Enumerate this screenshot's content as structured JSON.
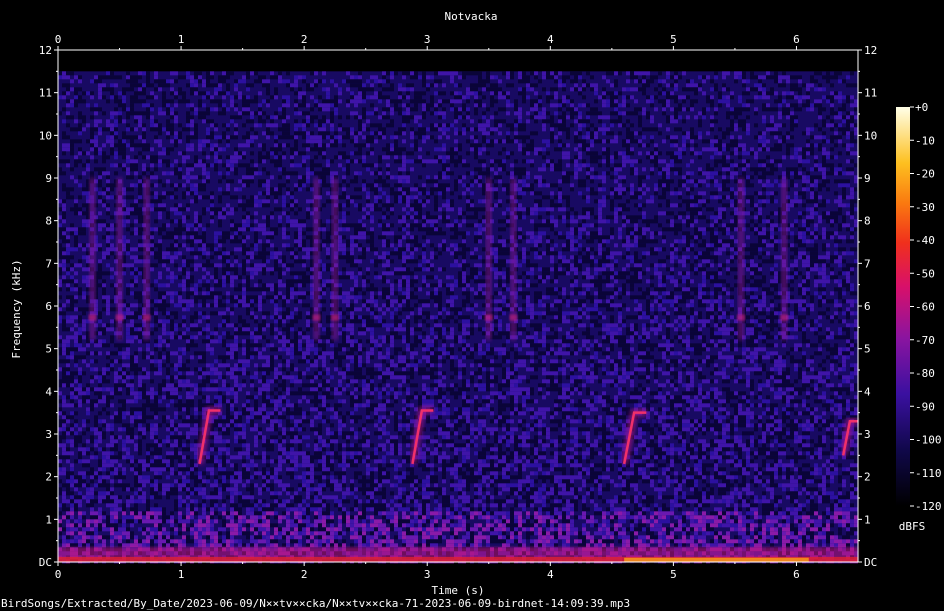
{
  "chart_data": {
    "type": "heatmap",
    "title": "Notvacka",
    "xlabel": "Time (s)",
    "ylabel": "Frequency (kHz)",
    "xlim": [
      0,
      6.5
    ],
    "ylim": [
      0,
      12
    ],
    "x_ticks": [
      0,
      1,
      2,
      3,
      4,
      5,
      6
    ],
    "y_ticks": [
      "DC",
      "1",
      "2",
      "3",
      "4",
      "5",
      "6",
      "7",
      "8",
      "9",
      "10",
      "11",
      "12"
    ],
    "colorbar": {
      "unit": "dBFS",
      "ticks": [
        "+0",
        "-10",
        "-20",
        "-30",
        "-40",
        "-50",
        "-60",
        "-70",
        "-80",
        "-90",
        "-100",
        "-110",
        "-120"
      ],
      "range": [
        -120,
        0
      ]
    },
    "background_ceiling_khz": 11.5,
    "low_freq_energy_band_khz": [
      0,
      1.2
    ],
    "calls": [
      {
        "start_s": 1.15,
        "end_s": 1.32,
        "low_khz": 2.3,
        "high_khz": 3.55
      },
      {
        "start_s": 2.88,
        "end_s": 3.05,
        "low_khz": 2.3,
        "high_khz": 3.55
      },
      {
        "start_s": 4.6,
        "end_s": 4.78,
        "low_khz": 2.3,
        "high_khz": 3.5
      },
      {
        "start_s": 6.38,
        "end_s": 6.5,
        "low_khz": 2.5,
        "high_khz": 3.3
      }
    ],
    "vertical_streaks_s": [
      0.28,
      0.5,
      0.72,
      2.1,
      2.25,
      3.5,
      3.7,
      5.55,
      5.9
    ],
    "colormap": [
      "#000000",
      "#1a0a5a",
      "#5a1aa0",
      "#b01a8a",
      "#e8203a",
      "#f87a10",
      "#ffd020",
      "#ffffe0"
    ]
  },
  "footer": {
    "path": "BirdSongs/Extracted/By_Date/2023-06-09/N××tv××cka/N××tv××cka-71-2023-06-09-birdnet-14:09:39.mp3"
  }
}
